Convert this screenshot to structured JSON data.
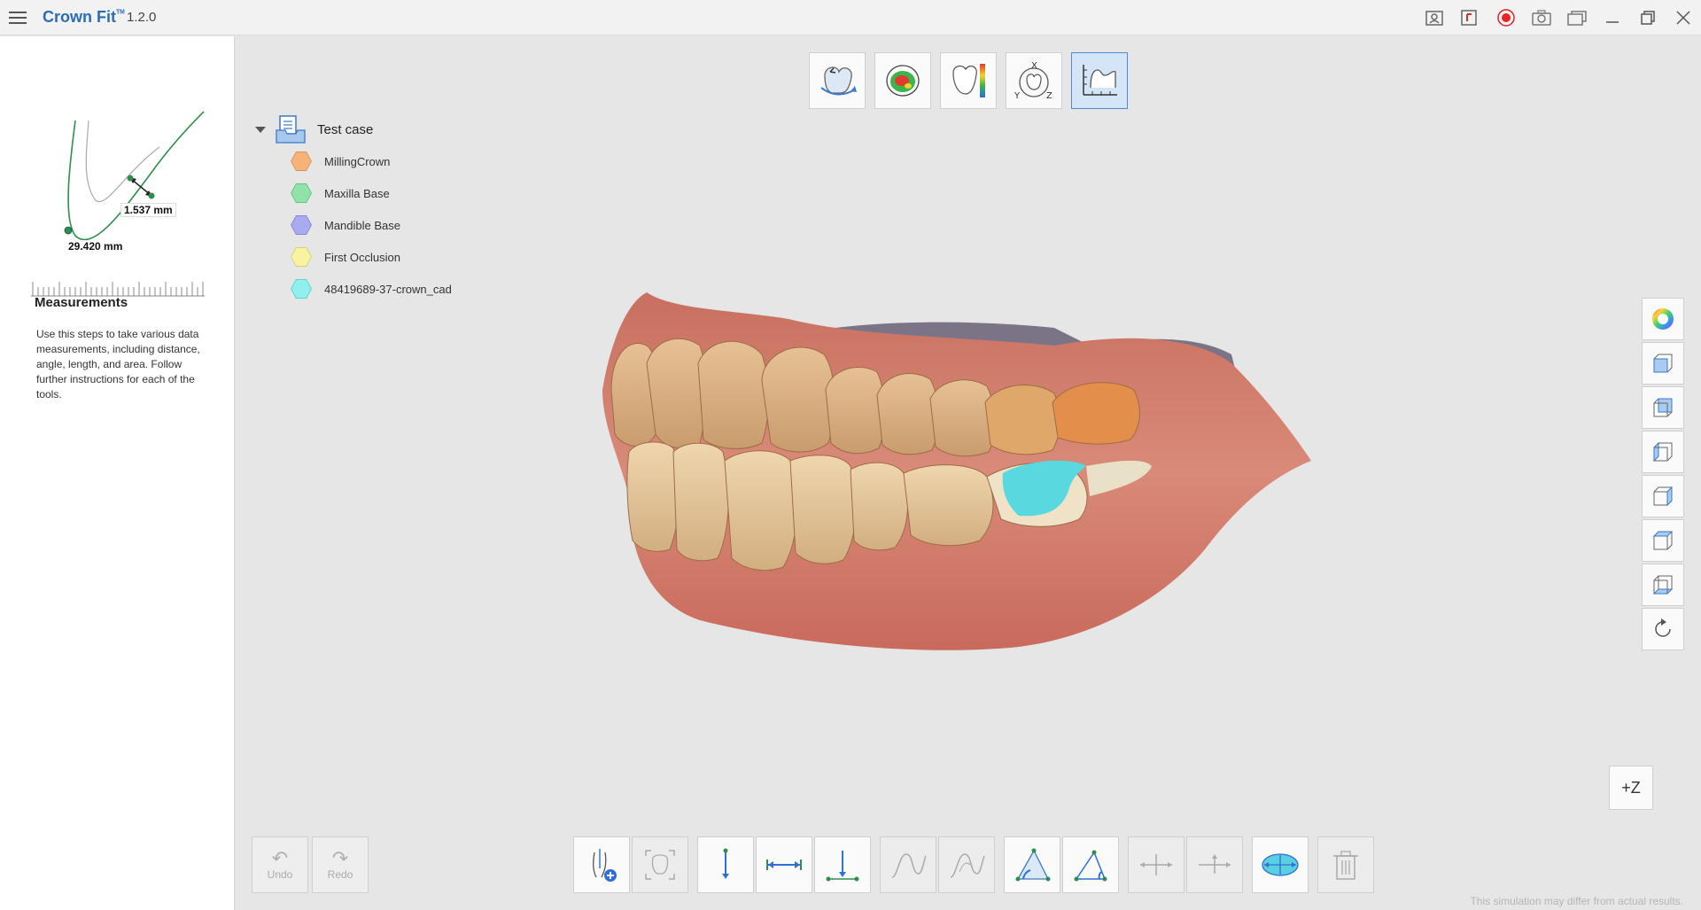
{
  "app": {
    "title": "Crown Fit",
    "badge": "ᵀᴹ",
    "version": "1.2.0"
  },
  "titlebar_icons": [
    "report-icon",
    "export-icon",
    "record-icon",
    "camera-icon",
    "window-capture-icon",
    "minimize-icon",
    "restore-icon",
    "close-icon"
  ],
  "left_panel": {
    "measurement_a": "1.537 mm",
    "measurement_b": "29.420 mm",
    "heading": "Measurements",
    "description": "Use this steps to take various data measurements, including distance, angle, length, and area. Follow further instructions for each of the tools."
  },
  "top_toolbar": {
    "tools": [
      "rotate-tooth-icon",
      "occlusion-map-icon",
      "color-scale-icon",
      "xyz-axis-icon",
      "measure-icon"
    ],
    "active": "measure-icon"
  },
  "tree": {
    "root_label": "Test case",
    "items": [
      {
        "label": "MillingCrown",
        "color": "#f5b37a",
        "border": "#d9935a"
      },
      {
        "label": "Maxilla Base",
        "color": "#8fe3a8",
        "border": "#62c283"
      },
      {
        "label": "Mandible Base",
        "color": "#a9aaf0",
        "border": "#8688d4"
      },
      {
        "label": "First Occlusion",
        "color": "#f7f3a0",
        "border": "#d6d175"
      },
      {
        "label": "48419689-37-crown_cad",
        "color": "#8ff0ee",
        "border": "#5fd0ce"
      }
    ]
  },
  "view_toolbar": [
    "color-wheel-icon",
    "view-front-icon",
    "view-back-icon",
    "view-left-icon",
    "view-right-icon",
    "view-top-icon",
    "view-bottom-icon",
    "reset-view-icon"
  ],
  "z_button": "+Z",
  "undo": {
    "label": "Undo"
  },
  "redo": {
    "label": "Redo"
  },
  "bottom_toolbar": [
    "add-plane-icon",
    "bounding-frame-icon",
    "vertical-distance-icon",
    "horizontal-distance-icon",
    "perpendicular-distance-icon",
    "curve-length-icon",
    "curve-length-alt-icon",
    "angle-icon",
    "triangle-angle-icon",
    "move-axis-icon",
    "move-axis-alt-icon",
    "area-icon",
    "delete-icon"
  ],
  "footer_note": "This simulation may differ from actual results."
}
